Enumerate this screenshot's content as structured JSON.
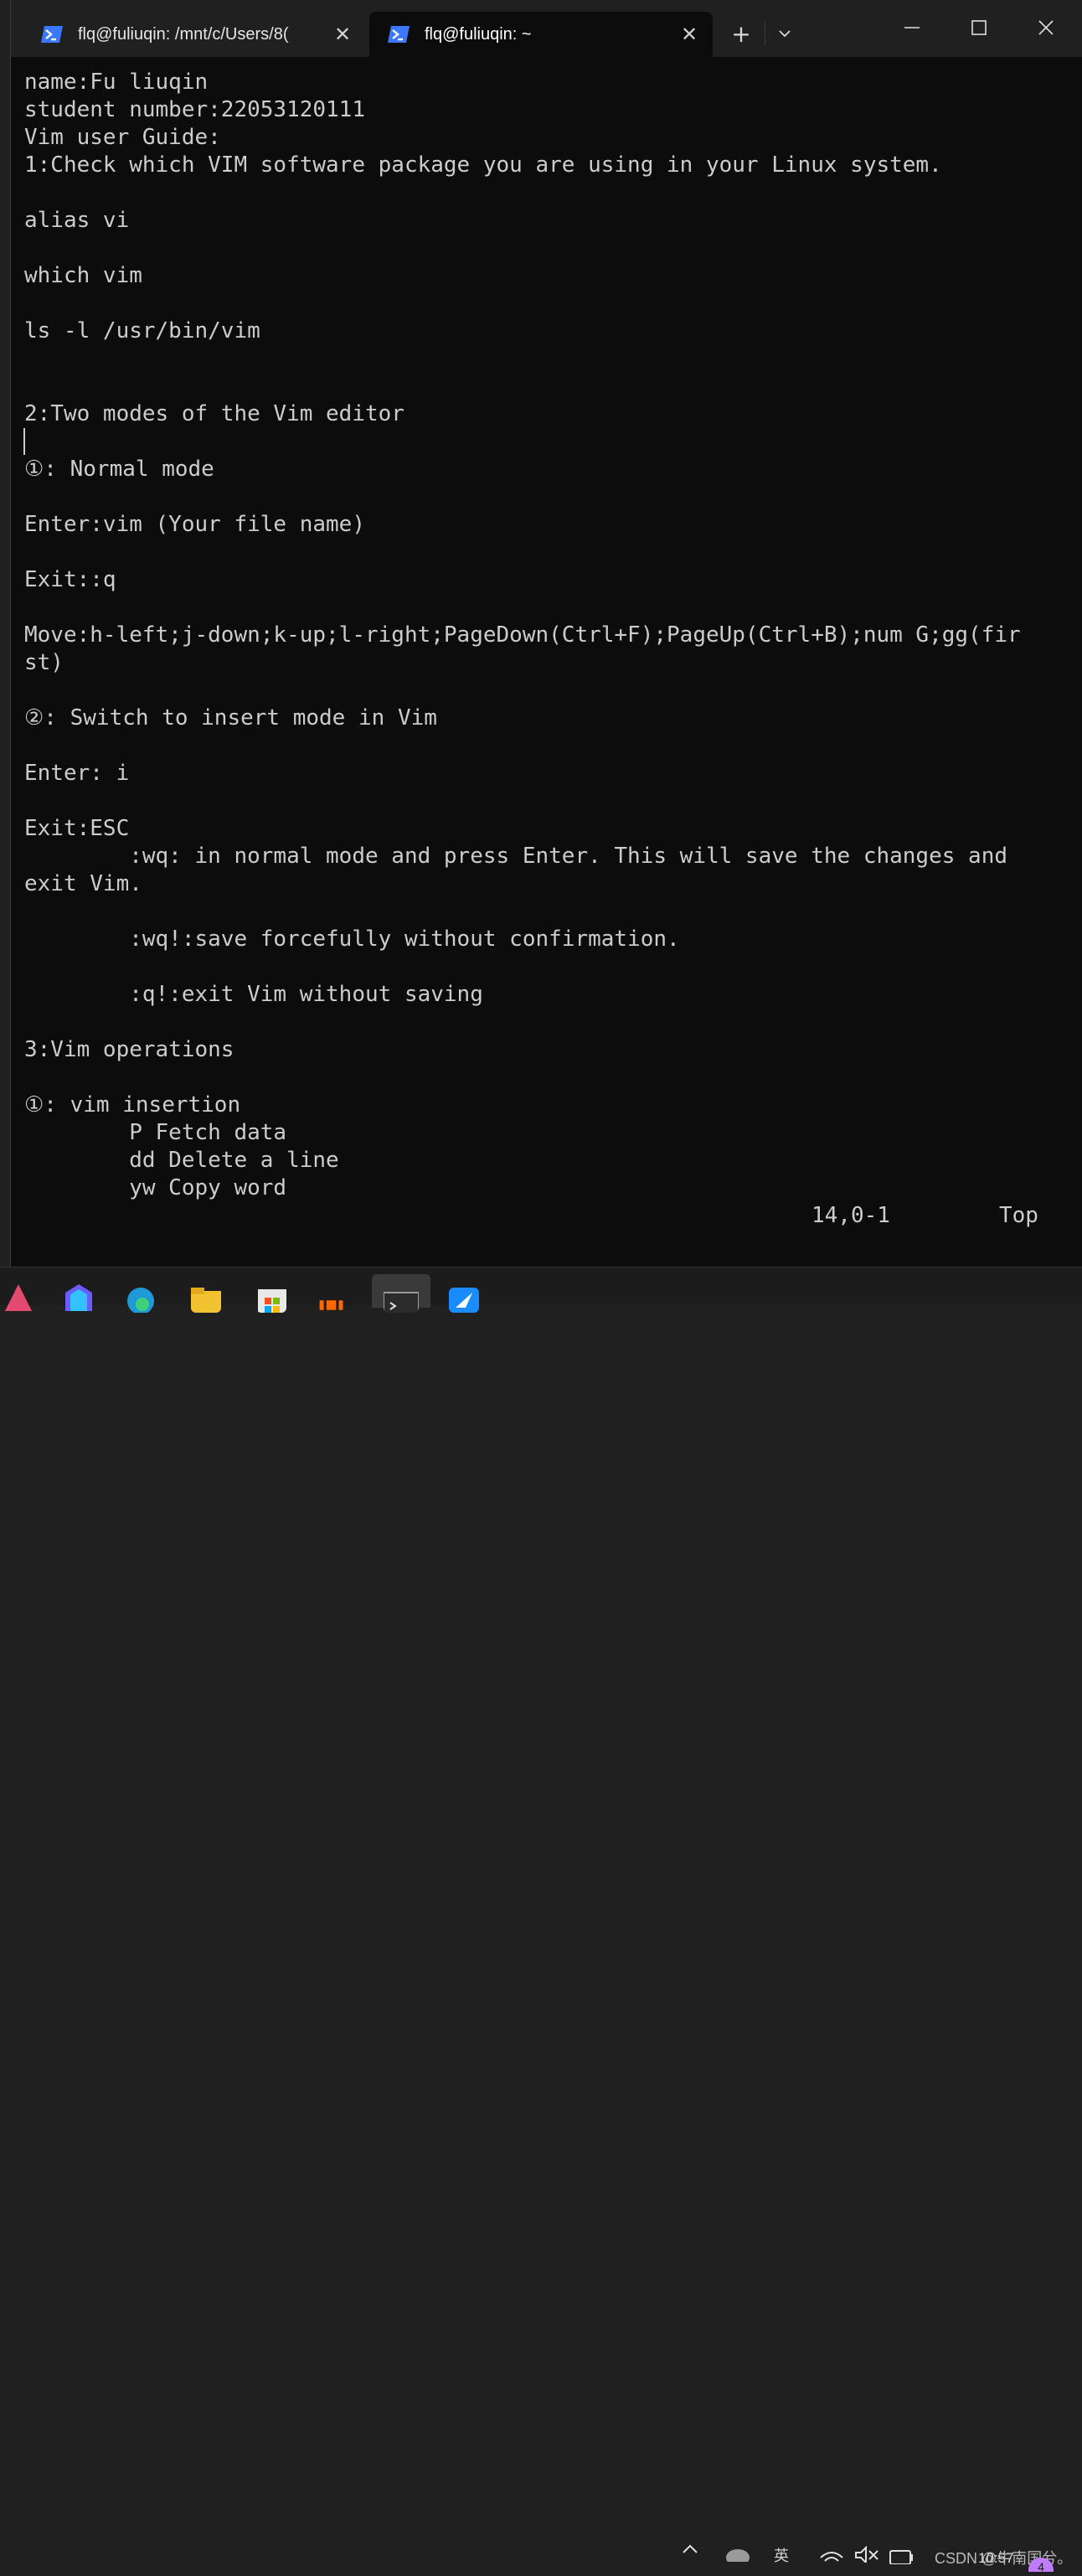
{
  "tabs": [
    {
      "title": "flq@fuliuqin: /mnt/c/Users/8(",
      "close": "✕"
    },
    {
      "title": "flq@fuliuqin: ~",
      "close": "✕"
    }
  ],
  "tab_actions": {
    "new_tab": "+",
    "dropdown": "⌄"
  },
  "terminal_lines": [
    "name:Fu liuqin",
    "student number:22053120111",
    "Vim user Guide:",
    "1:Check which VIM software package you are using in your Linux system.",
    "",
    "alias vi",
    "",
    "which vim",
    "",
    "ls -l /usr/bin/vim",
    "",
    "",
    "2:Two modes of the Vim editor",
    "",
    "①: Normal mode",
    "",
    "Enter:vim (Your file name)",
    "",
    "Exit::q",
    "",
    "Move:h-left;j-down;k-up;l-right;PageDown(Ctrl+F);PageUp(Ctrl+B);num G;gg(fir",
    "st)",
    "",
    "②: Switch to insert mode in Vim",
    "",
    "Enter: i",
    "",
    "Exit:ESC",
    "        :wq: in normal mode and press Enter. This will save the changes and",
    "exit Vim.",
    "",
    "        :wq!:save forcefully without confirmation.",
    "",
    "        :q!:exit Vim without saving",
    "",
    "3:Vim operations",
    "",
    "①: vim insertion",
    "        P Fetch data",
    "        dd Delete a line",
    "        yw Copy word"
  ],
  "status": {
    "position": "14,0-1",
    "scroll": "Top"
  },
  "tray": {
    "ime": "英",
    "watermark": "CSDN @牛南国兮。",
    "clock": "10:57",
    "badge": "4"
  },
  "colors": {
    "terminal_bg": "#0c0c0c",
    "text": "#cccccc",
    "titlebar": "#202020",
    "accent": "#3b78ff"
  }
}
